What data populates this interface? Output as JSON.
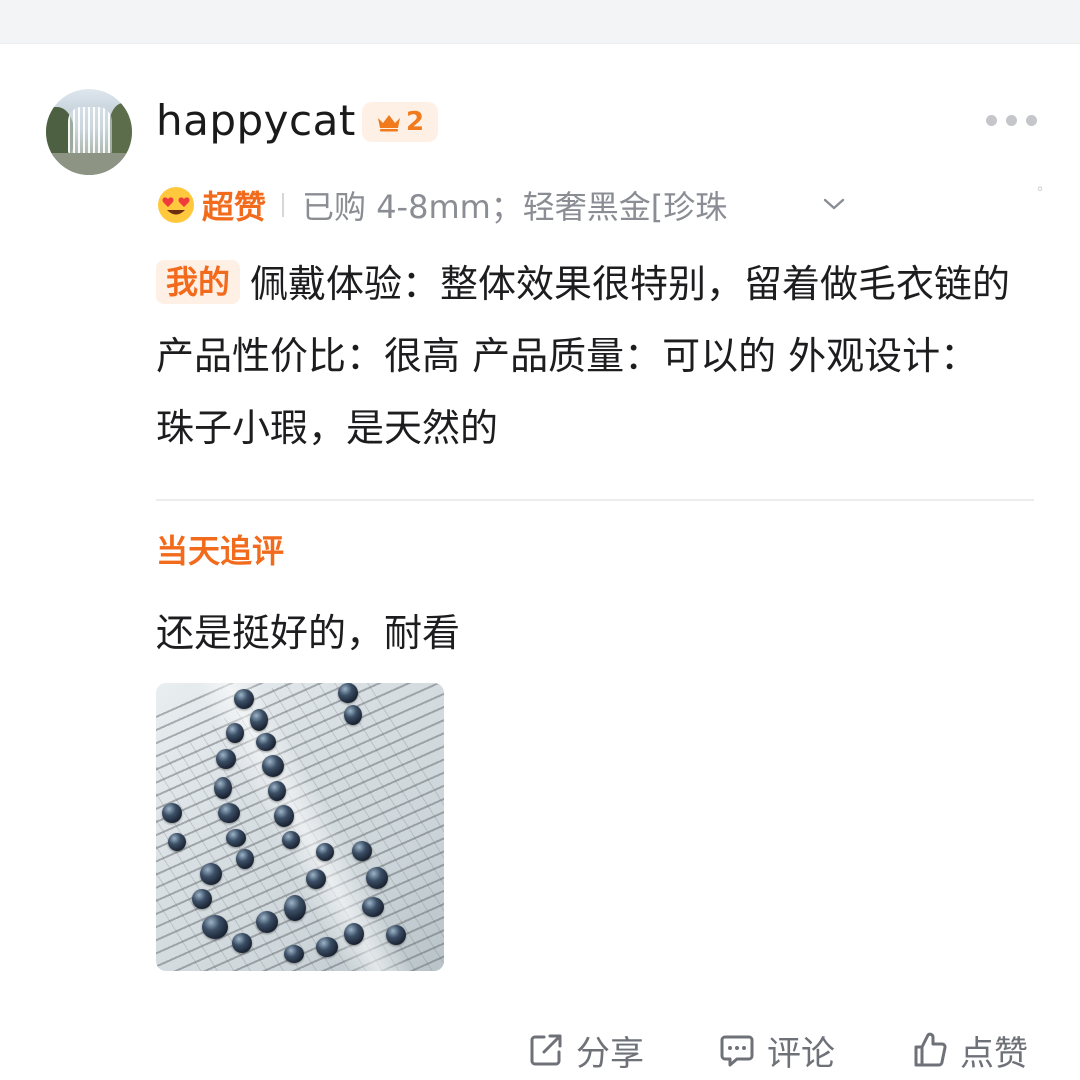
{
  "user": {
    "name": "happycat",
    "level": "2"
  },
  "rating": {
    "label": "超赞",
    "purchased": "已购 4-8mm；轻奢黑金[珍珠"
  },
  "review": {
    "tag": "我的",
    "text": "佩戴体验：整体效果很特别，留着做毛衣链的 产品性价比：很高 产品质量：可以的 外观设计：珠子小瑕，是天然的"
  },
  "followup": {
    "title": "当天追评",
    "text": "还是挺好的，耐看"
  },
  "actions": {
    "share": "分享",
    "comment": "评论",
    "like": "点赞"
  },
  "colors": {
    "accent": "#f26a1b",
    "muted": "#8a8d93",
    "badge_bg": "#fff0e6"
  },
  "icons": [
    "crown-icon",
    "more-icon",
    "heart-eyes-emoji-icon",
    "chevron-down-icon",
    "share-icon",
    "comment-icon",
    "thumbs-up-icon"
  ]
}
